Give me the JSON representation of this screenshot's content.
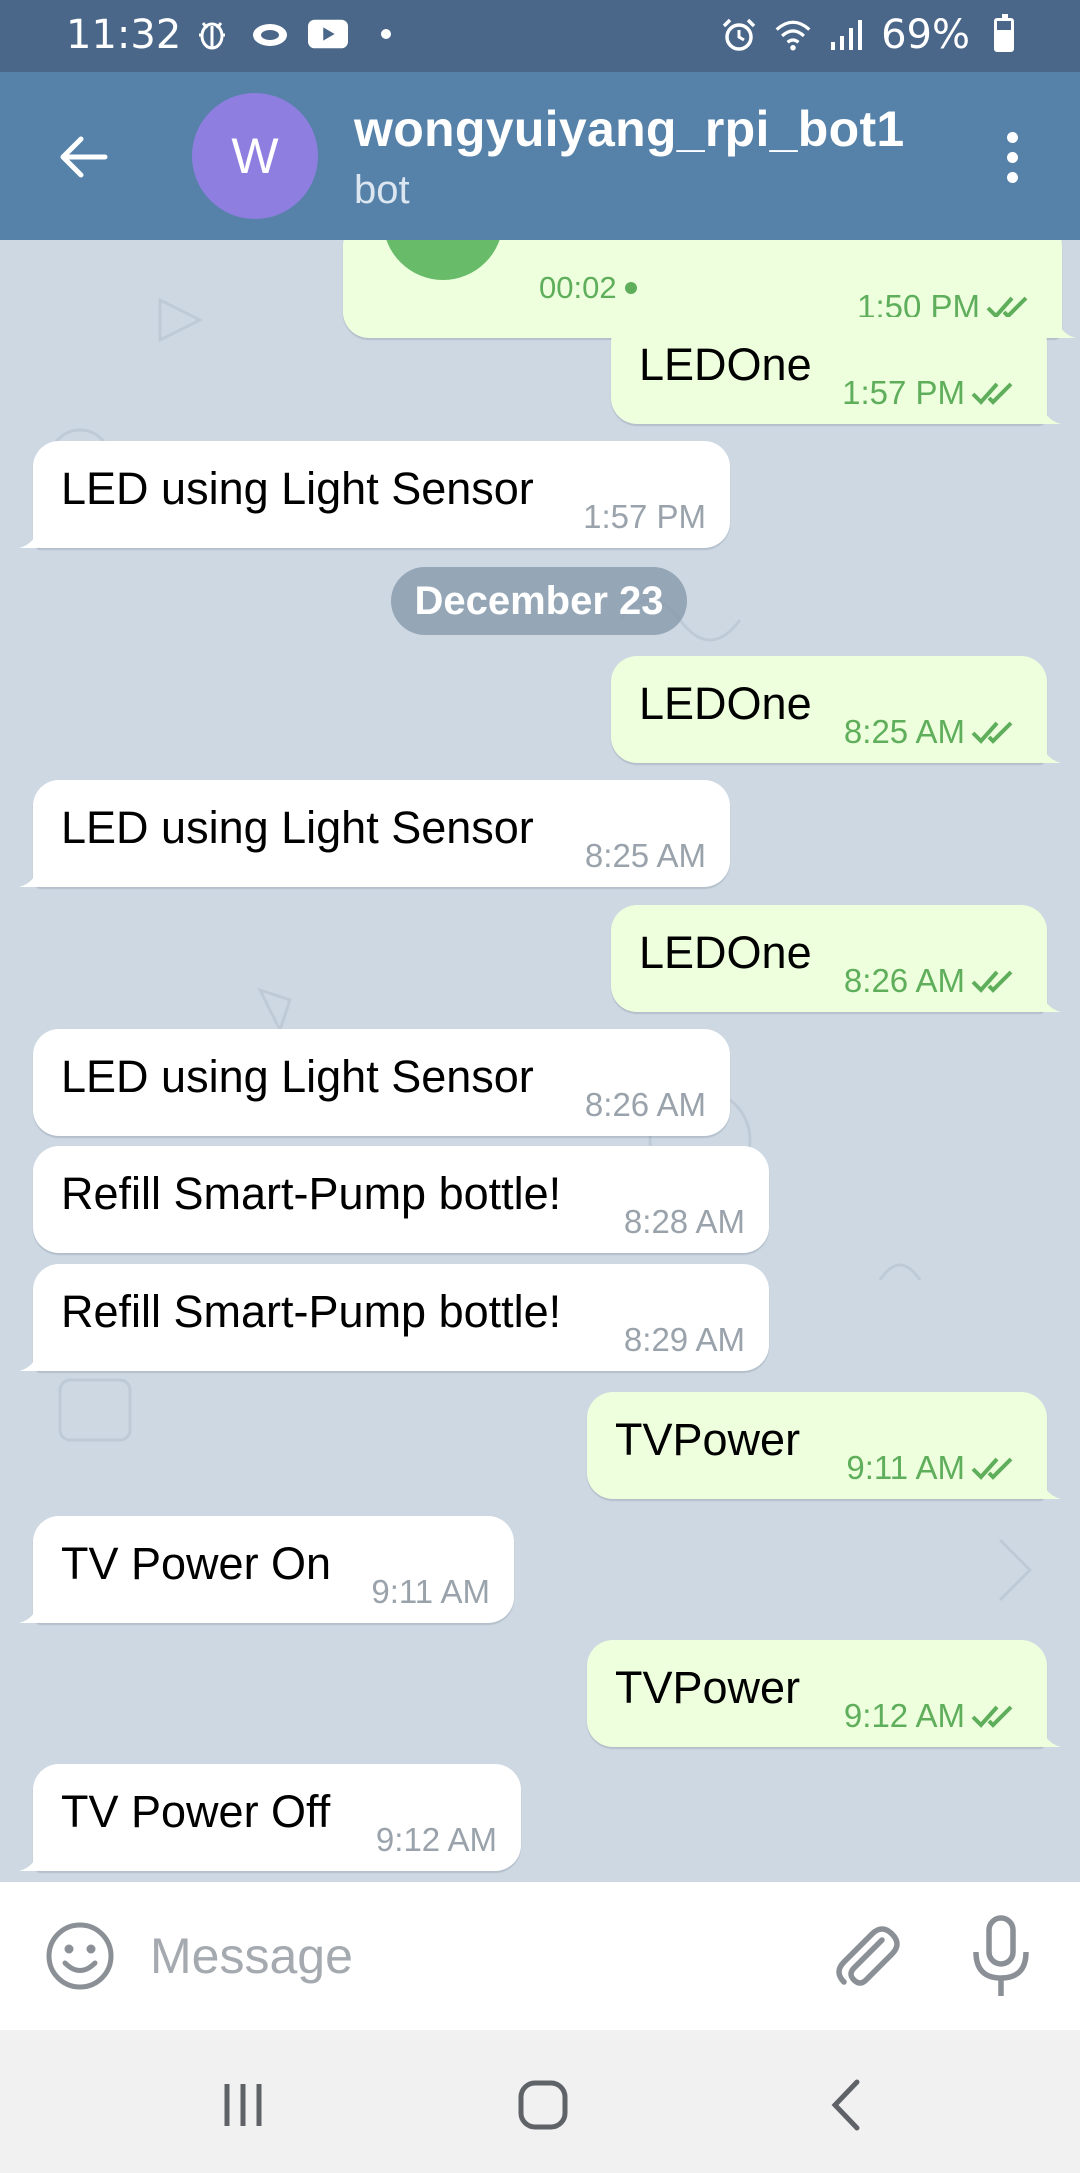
{
  "status_bar": {
    "time": "11:32",
    "battery": "69%",
    "battery_level": 0.69,
    "left_icons": [
      "bug-icon",
      "cloud-icon",
      "youtube-icon",
      "dot-icon"
    ],
    "right_icons": [
      "alarm-icon",
      "wifi-icon",
      "signal-icon",
      "battery-icon"
    ]
  },
  "header": {
    "avatar_letter": "W",
    "avatar_color": "#8e7ee0",
    "title": "wongyuiyang_rpi_bot1",
    "subtitle": "bot"
  },
  "messages": [
    {
      "dir": "out",
      "voice_duration": "00:02",
      "time": "1:50 PM",
      "read": true
    },
    {
      "dir": "out",
      "text": "LEDOne",
      "time": "1:57 PM",
      "read": true
    },
    {
      "dir": "in",
      "text": "LED using Light Sensor",
      "time": "1:57 PM"
    },
    {
      "dir": "out",
      "text": "LEDOne",
      "time": "8:25 AM",
      "read": true
    },
    {
      "dir": "in",
      "text": "LED using Light Sensor",
      "time": "8:25 AM"
    },
    {
      "dir": "out",
      "text": "LEDOne",
      "time": "8:26 AM",
      "read": true
    },
    {
      "dir": "in",
      "text": "LED using Light Sensor",
      "time": "8:26 AM"
    },
    {
      "dir": "in",
      "text": "Refill Smart-Pump bottle!",
      "time": "8:28 AM"
    },
    {
      "dir": "in",
      "text": "Refill Smart-Pump bottle!",
      "time": "8:29 AM"
    },
    {
      "dir": "out",
      "text": "TVPower",
      "time": "9:11 AM",
      "read": true
    },
    {
      "dir": "in",
      "text": "TV Power On",
      "time": "9:11 AM"
    },
    {
      "dir": "out",
      "text": "TVPower",
      "time": "9:12 AM",
      "read": true
    },
    {
      "dir": "in",
      "text": "TV Power Off",
      "time": "9:12 AM"
    }
  ],
  "date_separator": "December 23",
  "input": {
    "placeholder": "Message",
    "value": ""
  },
  "colors": {
    "status_bar": "#4a6789",
    "header": "#5682a9",
    "chat_bg": "#cdd8e2",
    "incoming_bubble": "#ffffff",
    "outgoing_bubble": "#eeffde",
    "outgoing_meta": "#5fae5b"
  }
}
